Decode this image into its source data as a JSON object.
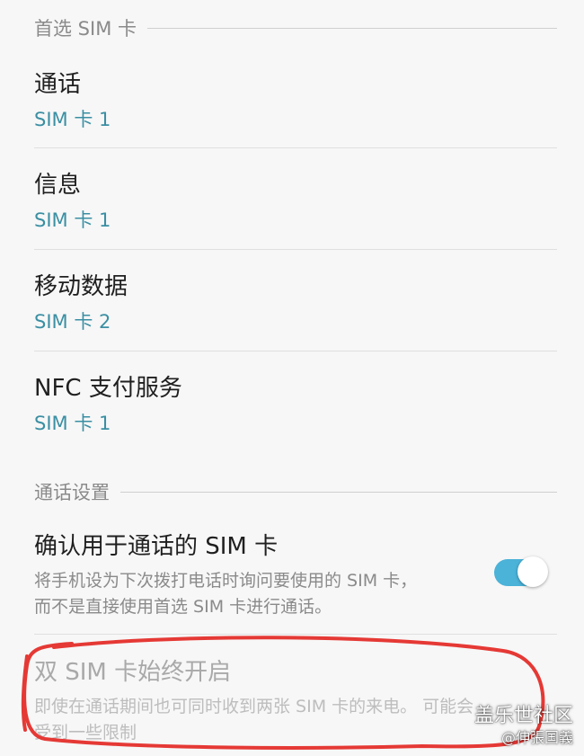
{
  "section_preferred_sim": {
    "header": "首选 SIM 卡",
    "items": [
      {
        "title": "通话",
        "value": "SIM 卡 1"
      },
      {
        "title": "信息",
        "value": "SIM 卡 1"
      },
      {
        "title": "移动数据",
        "value": "SIM 卡 2"
      },
      {
        "title": "NFC 支付服务",
        "value": "SIM 卡 1"
      }
    ]
  },
  "section_call_settings": {
    "header": "通话设置",
    "confirm_sim": {
      "title": "确认用于通话的 SIM 卡",
      "desc_line1": "将手机设为下次拨打电话时询问要使用的 SIM 卡，",
      "desc_line2": "而不是直接使用首选 SIM 卡进行通话。",
      "enabled": true
    },
    "dual_sim_always_on": {
      "title": "双 SIM 卡始终开启",
      "desc_line1": "即使在通话期间也可同时收到两张 SIM 卡的来电。 可能会",
      "desc_line2": "受到一些限制"
    }
  },
  "watermark": {
    "line1": "盖乐世社区",
    "line2": "@伸張国義"
  },
  "colors": {
    "accent": "#3a8fa3",
    "switch_on": "#4bb2d8",
    "annotation_red": "#e53935"
  }
}
